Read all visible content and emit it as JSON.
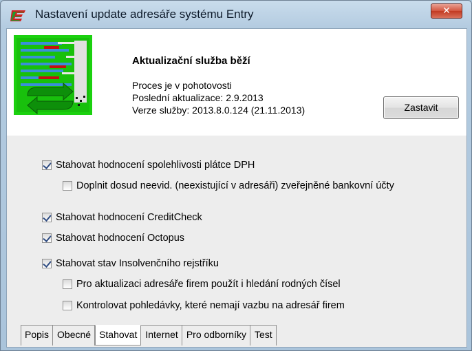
{
  "window": {
    "title": "Nastavení update adresáře systému Entry",
    "close_label": "✕"
  },
  "status": {
    "title": "Aktualizační služba běží",
    "lines": [
      "Proces je v pohotovosti",
      "Poslední aktualizace: 2.9.2013",
      "Verze služby: 2013.8.0.124 (21.11.2013)"
    ],
    "stop_label": "Zastavit"
  },
  "options": [
    {
      "label": "Stahovat hodnocení spolehlivosti plátce DPH",
      "checked": true
    },
    {
      "label": "Doplnit dosud neevid. (neexistující v adresáři) zveřejněné bankovní účty",
      "checked": false
    },
    {
      "label": "Stahovat hodnocení CreditCheck",
      "checked": true
    },
    {
      "label": "Stahovat hodnocení Octopus",
      "checked": true
    },
    {
      "label": "Stahovat stav Insolvenčního rejstříku",
      "checked": true
    },
    {
      "label": "Pro aktualizaci adresáře firem použít i hledání rodných čísel",
      "checked": false
    },
    {
      "label": "Kontrolovat pohledávky, které nemají vazbu na adresář firem",
      "checked": false
    }
  ],
  "tabs": [
    {
      "label": "Popis"
    },
    {
      "label": "Obecné"
    },
    {
      "label": "Stahovat",
      "active": true
    },
    {
      "label": "Internet"
    },
    {
      "label": "Pro odborníky"
    },
    {
      "label": "Test"
    }
  ],
  "colors": {
    "logo_green": "#1bd10f",
    "logo_blue": "#3a8fd8",
    "logo_red": "#c21010",
    "close_red": "#c23a22"
  }
}
